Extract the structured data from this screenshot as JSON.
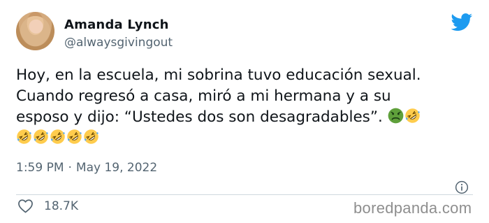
{
  "author": {
    "name": "Amanda Lynch",
    "handle": "@alwaysgivingout"
  },
  "tweet": {
    "lines": [
      "Hoy, en la escuela, mi sobrina tuvo educación sexual.",
      "Cuando regresó a casa, miró a mi hermana y a su",
      "esposo y dijo: “Ustedes dos son desagradables”."
    ],
    "emojis_line3": [
      "nauseated-face",
      "rolling-on-floor-laughing"
    ],
    "emojis_line4": [
      "rolling-on-floor-laughing",
      "rolling-on-floor-laughing",
      "rolling-on-floor-laughing",
      "rolling-on-floor-laughing",
      "rolling-on-floor-laughing"
    ]
  },
  "meta": {
    "time": "1:59 PM",
    "separator": "·",
    "date": "May 19, 2022"
  },
  "stats": {
    "likes": "18.7K"
  },
  "watermark": "boredpanda.com",
  "colors": {
    "twitter_blue": "#1d9bf0",
    "text": "#0f1419",
    "secondary": "#536471",
    "divider": "#cfd9de"
  },
  "icons": {
    "brand": "twitter-bird-icon",
    "info": "info-icon",
    "like": "heart-icon"
  }
}
